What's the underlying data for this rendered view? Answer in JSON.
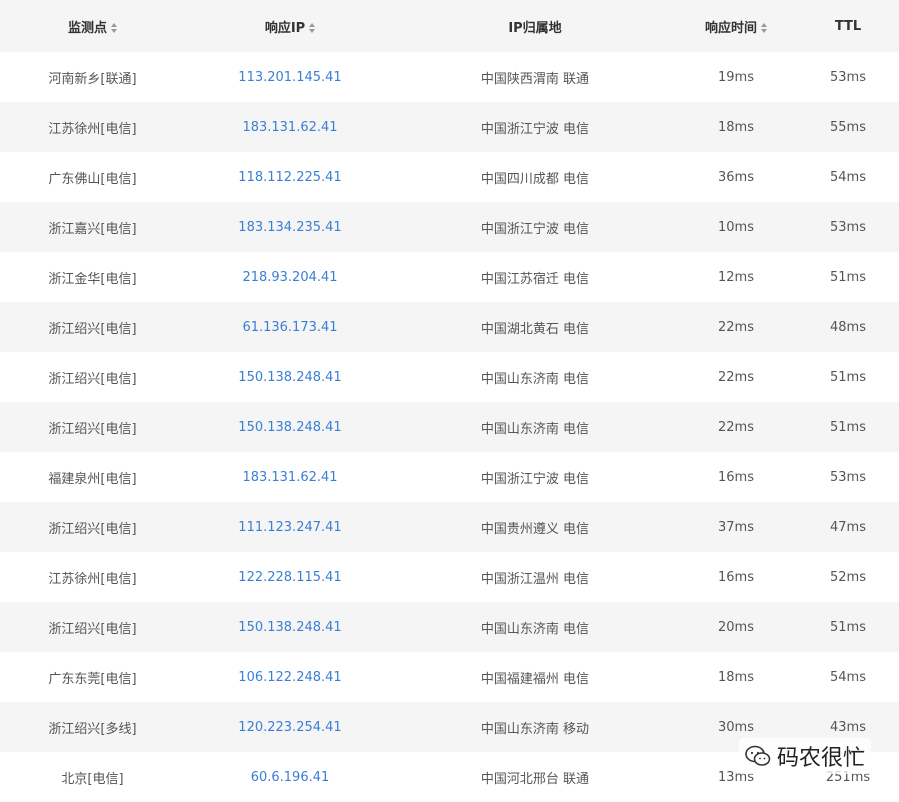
{
  "header": {
    "node": "监测点",
    "ip": "响应IP",
    "location": "IP归属地",
    "response_time": "响应时间",
    "ttl": "TTL"
  },
  "rows": [
    {
      "node": "河南新乡[联通]",
      "ip": "113.201.145.41",
      "location": "中国陕西渭南 联通",
      "time": "19ms",
      "ttl": "53ms"
    },
    {
      "node": "江苏徐州[电信]",
      "ip": "183.131.62.41",
      "location": "中国浙江宁波 电信",
      "time": "18ms",
      "ttl": "55ms"
    },
    {
      "node": "广东佛山[电信]",
      "ip": "118.112.225.41",
      "location": "中国四川成都 电信",
      "time": "36ms",
      "ttl": "54ms"
    },
    {
      "node": "浙江嘉兴[电信]",
      "ip": "183.134.235.41",
      "location": "中国浙江宁波 电信",
      "time": "10ms",
      "ttl": "53ms"
    },
    {
      "node": "浙江金华[电信]",
      "ip": "218.93.204.41",
      "location": "中国江苏宿迁 电信",
      "time": "12ms",
      "ttl": "51ms"
    },
    {
      "node": "浙江绍兴[电信]",
      "ip": "61.136.173.41",
      "location": "中国湖北黄石 电信",
      "time": "22ms",
      "ttl": "48ms"
    },
    {
      "node": "浙江绍兴[电信]",
      "ip": "150.138.248.41",
      "location": "中国山东济南 电信",
      "time": "22ms",
      "ttl": "51ms"
    },
    {
      "node": "浙江绍兴[电信]",
      "ip": "150.138.248.41",
      "location": "中国山东济南 电信",
      "time": "22ms",
      "ttl": "51ms"
    },
    {
      "node": "福建泉州[电信]",
      "ip": "183.131.62.41",
      "location": "中国浙江宁波 电信",
      "time": "16ms",
      "ttl": "53ms"
    },
    {
      "node": "浙江绍兴[电信]",
      "ip": "111.123.247.41",
      "location": "中国贵州遵义 电信",
      "time": "37ms",
      "ttl": "47ms"
    },
    {
      "node": "江苏徐州[电信]",
      "ip": "122.228.115.41",
      "location": "中国浙江温州 电信",
      "time": "16ms",
      "ttl": "52ms"
    },
    {
      "node": "浙江绍兴[电信]",
      "ip": "150.138.248.41",
      "location": "中国山东济南 电信",
      "time": "20ms",
      "ttl": "51ms"
    },
    {
      "node": "广东东莞[电信]",
      "ip": "106.122.248.41",
      "location": "中国福建福州 电信",
      "time": "18ms",
      "ttl": "54ms"
    },
    {
      "node": "浙江绍兴[多线]",
      "ip": "120.223.254.41",
      "location": "中国山东济南 移动",
      "time": "30ms",
      "ttl": "43ms"
    },
    {
      "node": "北京[电信]",
      "ip": "60.6.196.41",
      "location": "中国河北邢台 联通",
      "time": "13ms",
      "ttl": "251ms"
    }
  ],
  "watermark": {
    "text": "码农很忙",
    "icon": "wechat-icon"
  },
  "colors": {
    "link": "#3a7fd6",
    "stripe": "#f5f5f5"
  }
}
